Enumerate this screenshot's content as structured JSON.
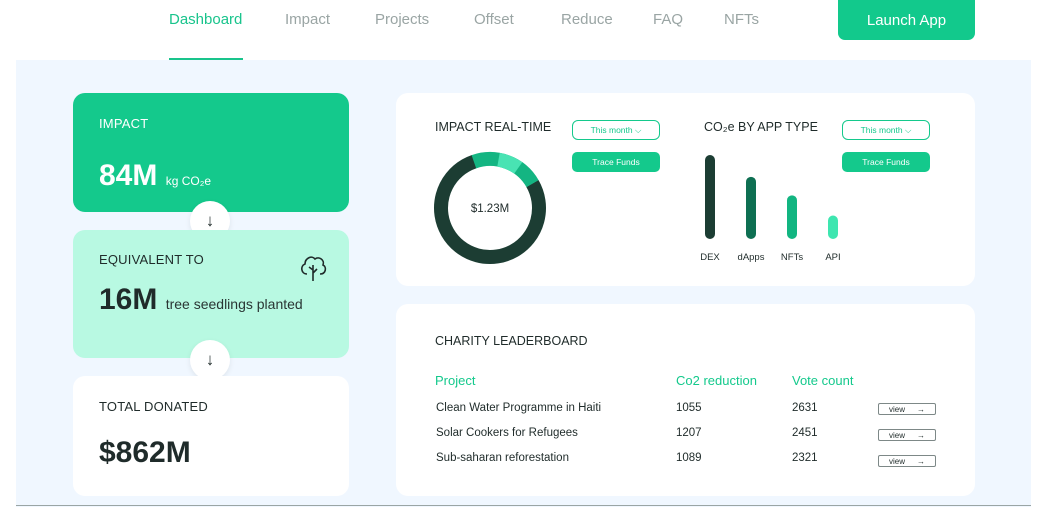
{
  "nav": {
    "items": [
      "Dashboard",
      "Impact",
      "Projects",
      "Offset",
      "Reduce",
      "FAQ",
      "NFTs"
    ],
    "active": "Dashboard",
    "launch_label": "Launch App"
  },
  "impact_card": {
    "label": "IMPACT",
    "value": "84M",
    "unit": "kg CO₂e"
  },
  "equivalent_card": {
    "label": "EQUIVALENT TO",
    "value": "16M",
    "unit": "tree seedlings planted"
  },
  "total_card": {
    "label": "TOTAL DONATED",
    "value": "$862M"
  },
  "realtime": {
    "title": "IMPACT REAL-TIME",
    "period": "This month ⌵",
    "trace_label": "Trace Funds",
    "center_value": "$1.23M",
    "segments": [
      0.78,
      0.22
    ]
  },
  "app_type": {
    "title": "CO₂e BY APP TYPE",
    "period": "This month ⌵",
    "trace_label": "Trace Funds"
  },
  "chart_data": {
    "type": "bar",
    "categories": [
      "DEX",
      "dApps",
      "NFTs",
      "API"
    ],
    "values": [
      100,
      74,
      52,
      28
    ],
    "colors": [
      "#1c3d33",
      "#0e6f52",
      "#12b581",
      "#3ee6b0"
    ]
  },
  "leaderboard": {
    "title": "CHARITY LEADERBOARD",
    "columns": [
      "Project",
      "Co2 reduction",
      "Vote count"
    ],
    "rows": [
      {
        "project": "Clean Water Programme in Haiti",
        "co2": "1055",
        "votes": "2631",
        "view": "view"
      },
      {
        "project": "Solar Cookers for Refugees",
        "co2": "1207",
        "votes": "2451",
        "view": "view"
      },
      {
        "project": "Sub-saharan reforestation",
        "co2": "1089",
        "votes": "2321",
        "view": "view"
      }
    ]
  },
  "colors": {
    "accent": "#14c98c",
    "mint": "#b8f9e2",
    "background": "#f0f7ff",
    "dark": "#1c3d33"
  }
}
